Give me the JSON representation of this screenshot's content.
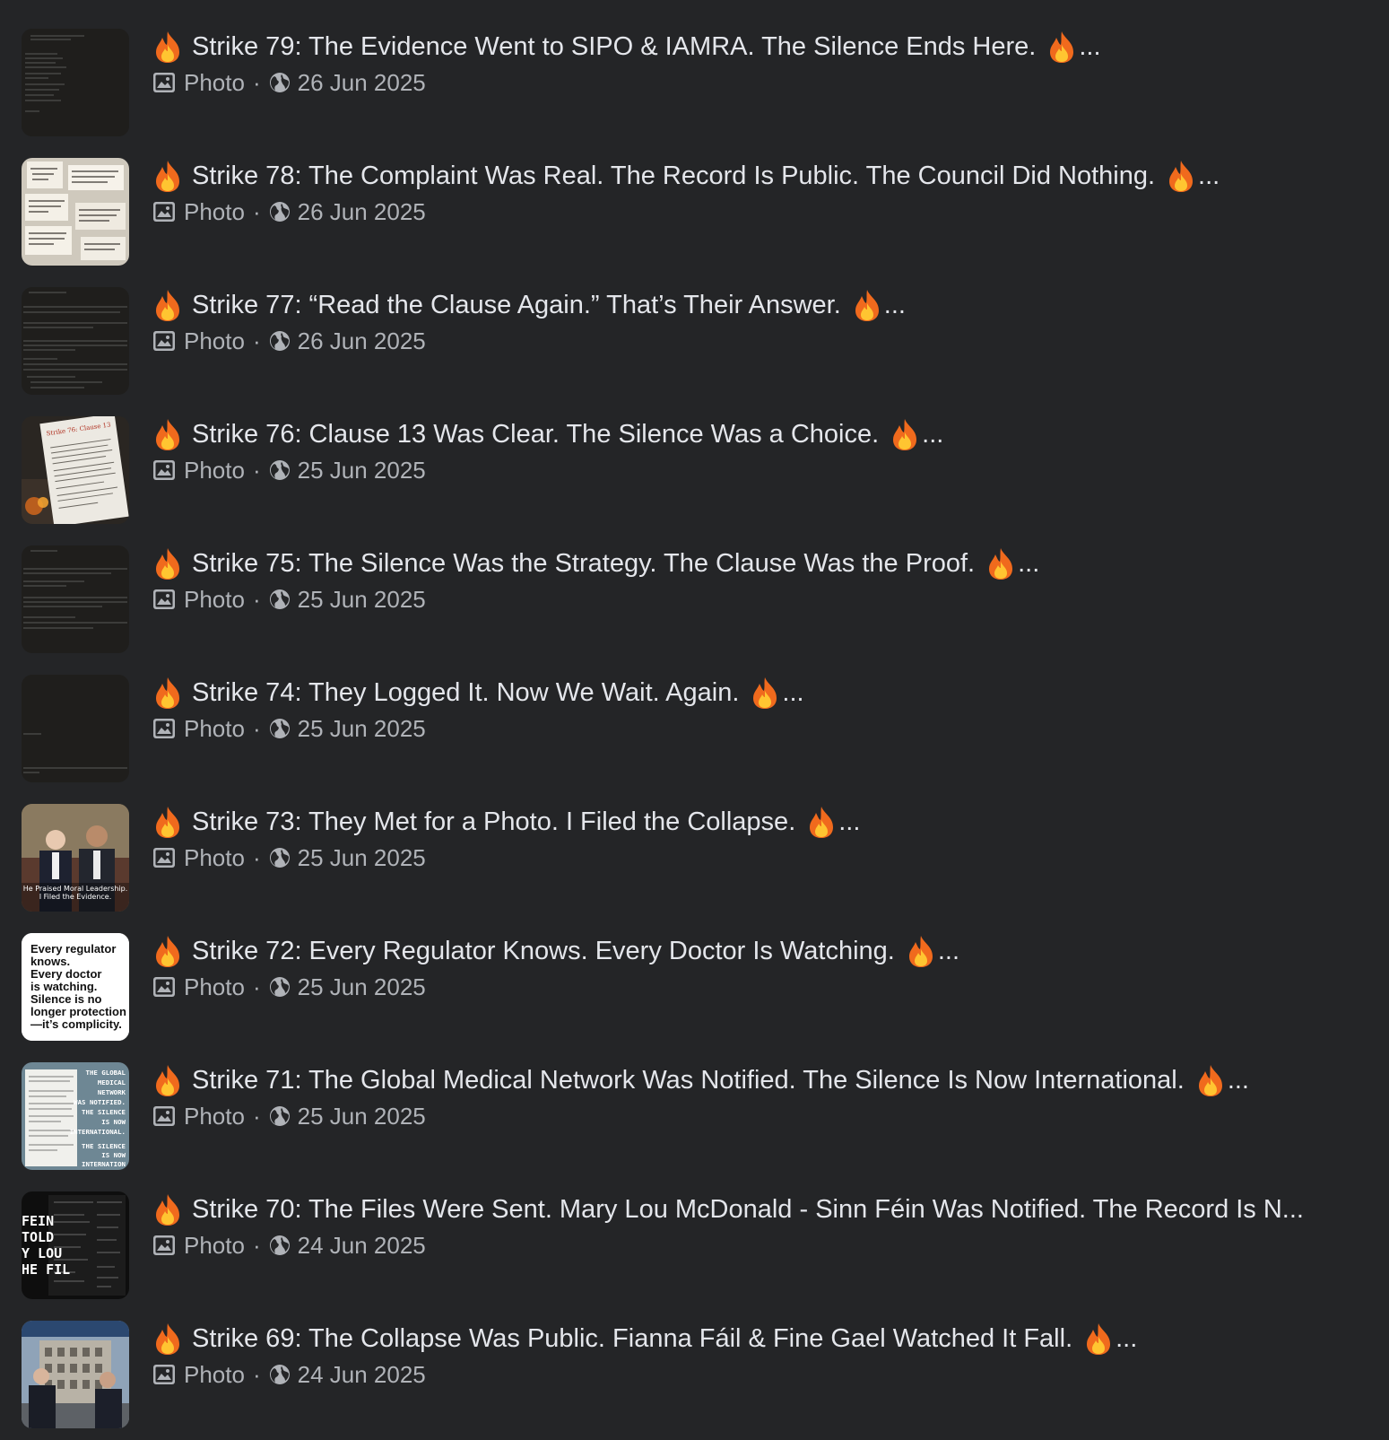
{
  "colors": {
    "background": "#242527",
    "title_text": "#e4e6eb",
    "meta_text": "#b0b3b8"
  },
  "posts": [
    {
      "title": "Strike 79: The Evidence Went to SIPO & IAMRA. The Silence Ends Here.",
      "ellipsis": "...",
      "type": "Photo",
      "date": "26 Jun 2025",
      "thumb": "dark-document"
    },
    {
      "title": "Strike 78: The Complaint Was Real. The Record Is Public. The Council Did Nothing.",
      "ellipsis": "...",
      "type": "Photo",
      "date": "26 Jun 2025",
      "thumb": "paper-clippings"
    },
    {
      "title": "Strike 77: “Read the Clause Again.” That’s Their Answer.",
      "ellipsis": "...",
      "type": "Photo",
      "date": "26 Jun 2025",
      "thumb": "dark-document"
    },
    {
      "title": "Strike 76: Clause 13 Was Clear. The Silence Was a Choice.",
      "ellipsis": "...",
      "type": "Photo",
      "date": "25 Jun 2025",
      "thumb": "document-fire"
    },
    {
      "title": "Strike 75: The Silence Was the Strategy. The Clause Was the Proof.",
      "ellipsis": "...",
      "type": "Photo",
      "date": "25 Jun 2025",
      "thumb": "dark-document"
    },
    {
      "title": "Strike 74: They Logged It. Now We Wait. Again.",
      "ellipsis": "...",
      "type": "Photo",
      "date": "25 Jun 2025",
      "thumb": "dark-document-sparse"
    },
    {
      "title": "Strike 73: They Met for a Photo. I Filed the Collapse.",
      "ellipsis": "...",
      "type": "Photo",
      "date": "25 Jun 2025",
      "thumb": "two-men-photo",
      "thumb_caption": [
        "He Praised Moral Leadership.",
        "I Filed the Evidence."
      ]
    },
    {
      "title": "Strike 72: Every Regulator Knows. Every Doctor Is Watching.",
      "ellipsis": "...",
      "type": "Photo",
      "date": "25 Jun 2025",
      "thumb": "white-quote",
      "thumb_lines": [
        "Every regulator",
        "knows.",
        "Every doctor",
        "is watching.",
        "Silence is no",
        "longer protection",
        "—it’s complicity."
      ]
    },
    {
      "title": "Strike 71: The Global Medical Network Was Notified. The Silence Is Now International.",
      "ellipsis": "...",
      "type": "Photo",
      "date": "25 Jun 2025",
      "thumb": "blue-poster",
      "thumb_lines": [
        "THE GLOBAL",
        "MEDICAL",
        "NETWORK",
        "WAS NOTIFIED.",
        "THE SILENCE",
        "IS NOW",
        "INTERNATIONAL.",
        "THE SILENCE",
        "IS NOW",
        "INTERNATION"
      ]
    },
    {
      "title": "Strike 70: The Files Were Sent. Mary Lou McDonald - Sinn Féin Was Notified. The Record Is N...",
      "ellipsis": "",
      "type": "Photo",
      "date": "24 Jun 2025",
      "thumb": "black-poster",
      "thumb_lines": [
        "FEIN",
        "TOLD",
        "Y LOU",
        "HE FIL"
      ]
    },
    {
      "title": "Strike 69: The Collapse Was Public. Fianna Fáil & Fine Gael Watched It Fall.",
      "ellipsis": "...",
      "type": "Photo",
      "date": "24 Jun 2025",
      "thumb": "building-photo"
    }
  ]
}
